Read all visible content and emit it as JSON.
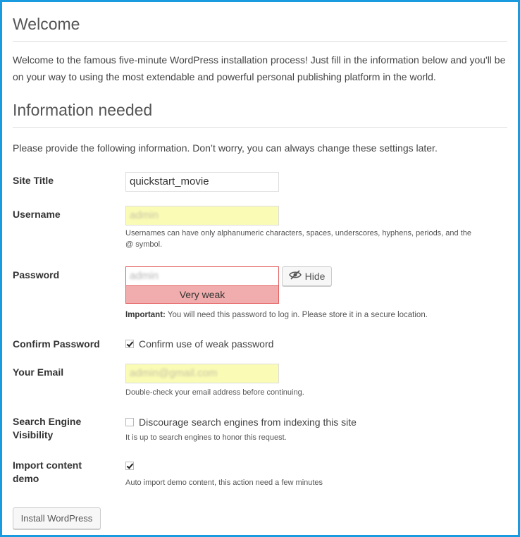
{
  "welcome": {
    "heading": "Welcome",
    "text": "Welcome to the famous five-minute WordPress installation process! Just fill in the information below and you'll be on your way to using the most extendable and powerful personal publishing platform in the world."
  },
  "info": {
    "heading": "Information needed",
    "text": "Please provide the following information. Don’t worry, you can always change these settings later."
  },
  "form": {
    "site_title": {
      "label": "Site Title",
      "value": "quickstart_movie"
    },
    "username": {
      "label": "Username",
      "value": "admin",
      "description": "Usernames can have only alphanumeric characters, spaces, underscores, hyphens, periods, and the @ symbol."
    },
    "password": {
      "label": "Password",
      "value": "admin",
      "strength": "Very weak",
      "hide_label": "Hide",
      "important_label": "Important:",
      "important_text": " You will need this password to log in. Please store it in a secure location."
    },
    "confirm_password": {
      "label": "Confirm Password",
      "checkbox_label": "Confirm use of weak password",
      "checked": true
    },
    "email": {
      "label": "Your Email",
      "value": "admin@gmail.com",
      "description": "Double-check your email address before continuing."
    },
    "search_visibility": {
      "label_line1": "Search Engine",
      "label_line2": "Visibility",
      "checkbox_label": "Discourage search engines from indexing this site",
      "checked": false,
      "description": "It is up to search engines to honor this request."
    },
    "import_demo": {
      "label_line1": "Import content",
      "label_line2": "demo",
      "checked": true,
      "description": "Auto import demo content, this action need a few minutes"
    }
  },
  "install_button": "Install WordPress",
  "colors": {
    "frame": "#1a9be0",
    "autofill": "#fafcb6",
    "weak_strength": "#f1adad",
    "weak_border": "#e35b5b"
  },
  "icons": {
    "hide": "eye-slash-icon"
  }
}
